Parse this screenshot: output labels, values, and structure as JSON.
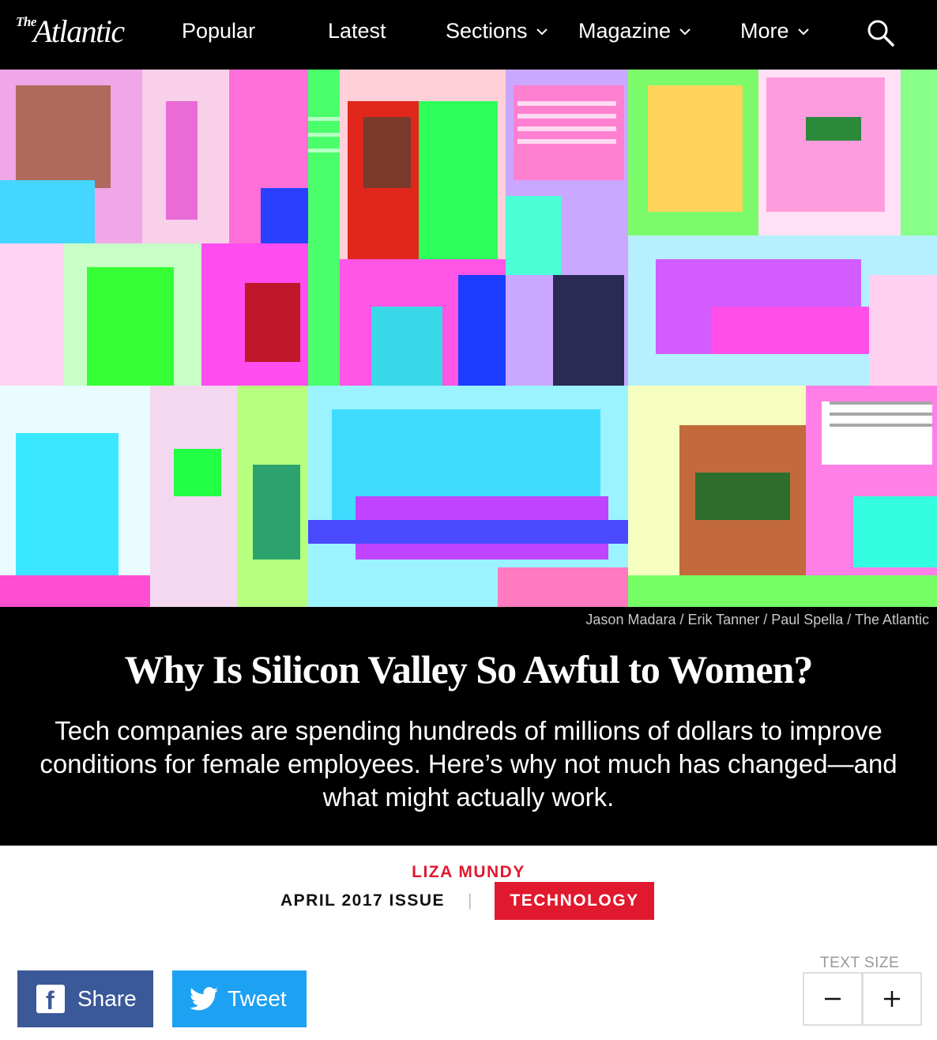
{
  "nav": {
    "logo_the": "The",
    "logo_name": "Atlantic",
    "items": [
      {
        "label": "Popular"
      },
      {
        "label": "Latest"
      },
      {
        "label": "Sections"
      },
      {
        "label": "Magazine"
      },
      {
        "label": "More"
      }
    ],
    "search_icon": "search-icon"
  },
  "hero": {
    "credit": "Jason Madara / Erik Tanner / Paul Spella / The Atlantic"
  },
  "article": {
    "headline": "Why Is Silicon Valley So Awful to Women?",
    "dek": "Tech companies are spending hundreds of millions of dollars to improve conditions for female employees. Here’s why not much has changed—and what might actually work.",
    "author": "LIZA MUNDY",
    "issue": "APRIL 2017 ISSUE",
    "separator": "|",
    "section": "TECHNOLOGY"
  },
  "share": {
    "facebook_label": "Share",
    "twitter_label": "Tweet"
  },
  "text_size": {
    "label": "TEXT SIZE",
    "minus": "−",
    "plus": "+"
  },
  "colors": {
    "accent_red": "#e0192e",
    "facebook": "#3b5998",
    "twitter": "#1da1f2"
  }
}
